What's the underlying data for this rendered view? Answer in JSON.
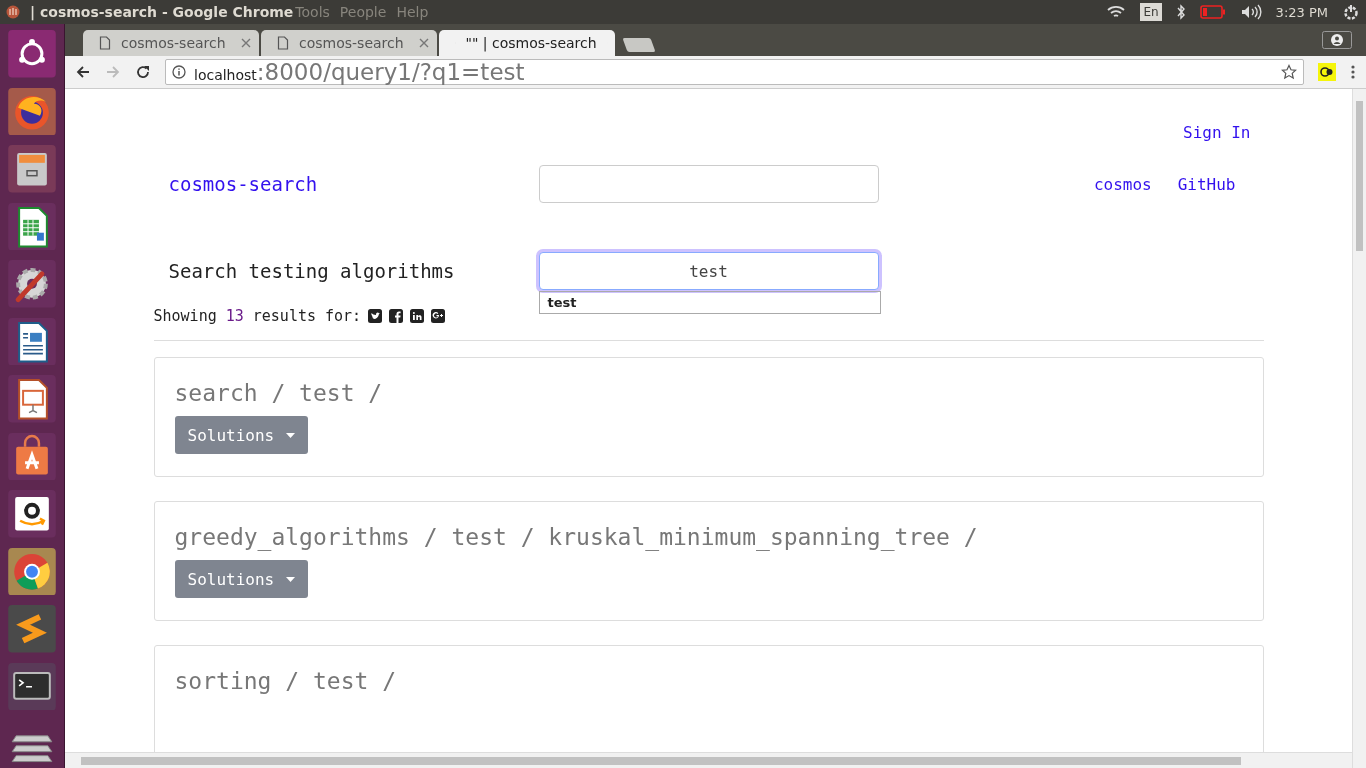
{
  "top_bar": {
    "title": "| cosmos-search - Google Chrome",
    "menu": [
      "Tools",
      "People",
      "Help"
    ],
    "keyboard": "En",
    "time": "3:23 PM"
  },
  "tabs": [
    {
      "label": "cosmos-search",
      "selected": false
    },
    {
      "label": "cosmos-search",
      "selected": false
    },
    {
      "label": "\"\" | cosmos-search",
      "selected": true
    }
  ],
  "address_bar": {
    "host": "localhost",
    "path": ":8000/query1/?q1=test"
  },
  "page": {
    "sign_in": "Sign In",
    "brand": "cosmos-search",
    "nav_links": [
      "cosmos",
      "GitHub"
    ],
    "search_label": "Search testing algorithms",
    "search_value": "test",
    "suggestions": [
      "test"
    ],
    "results_prefix": "Showing",
    "results_count": "13",
    "results_suffix": "results for:",
    "results": [
      {
        "path": "search / test /",
        "button": "Solutions"
      },
      {
        "path": "greedy_algorithms / test / kruskal_minimum_spanning_tree /",
        "button": "Solutions"
      },
      {
        "path": "sorting / test /"
      }
    ]
  }
}
